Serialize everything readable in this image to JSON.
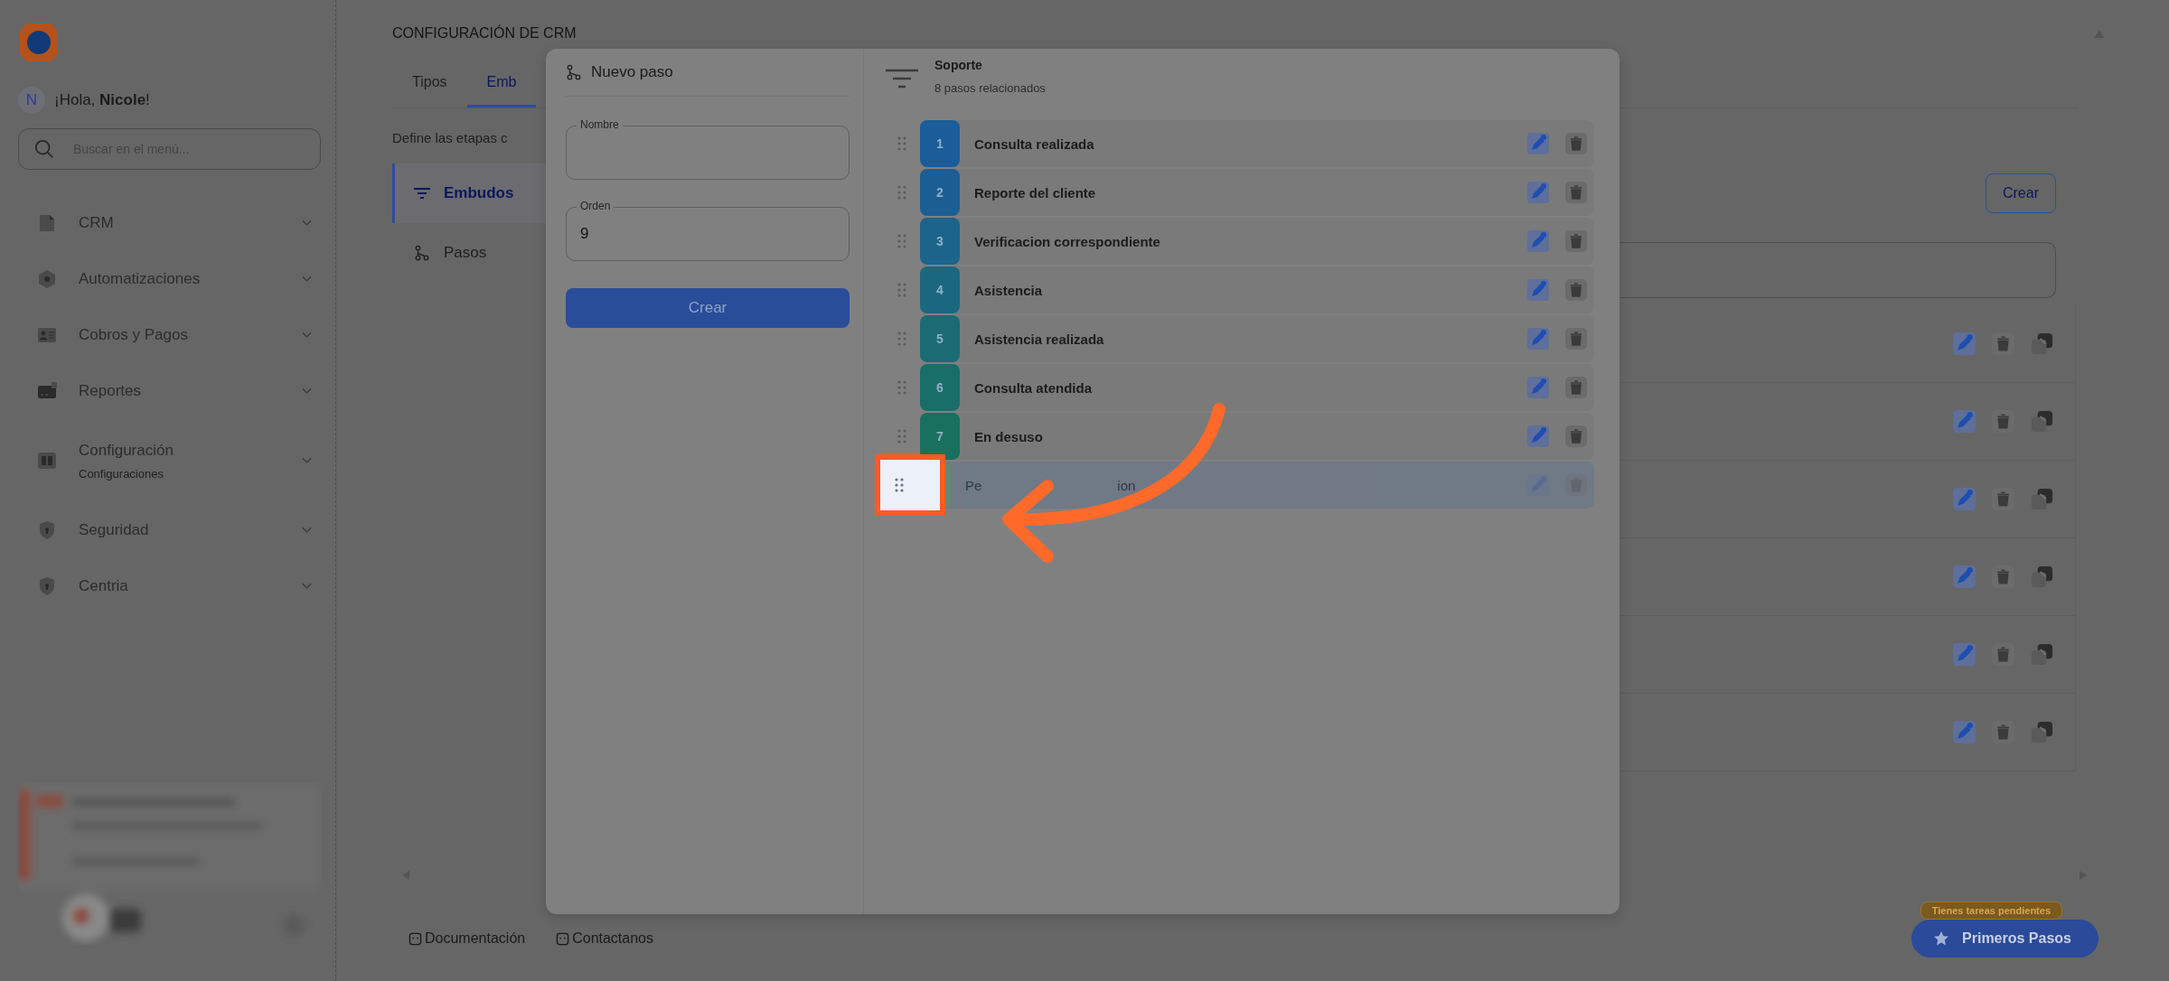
{
  "sidebar": {
    "avatar_initial": "N",
    "greeting": "¡Hola, **Nicole**!",
    "search": {
      "placeholder": "Buscar en el menú..."
    },
    "items": [
      {
        "label": "CRM",
        "expanded": false
      },
      {
        "label": "Automatizaciones",
        "expanded": false
      },
      {
        "label": "Cobros y Pagos",
        "expanded": false
      },
      {
        "label": "Reportes",
        "expanded": false
      },
      {
        "label": "Configuración",
        "sublabel": "Configuraciones",
        "expanded": false
      },
      {
        "label": "Seguridad",
        "expanded": false
      },
      {
        "label": "Centria",
        "expanded": false
      }
    ]
  },
  "page": {
    "title": "CONFIGURACIÓN DE CRM",
    "tabs": [
      {
        "label": "Tipos",
        "selected": false
      },
      {
        "label": "Emb",
        "selected": true
      }
    ],
    "description": "Define las etapas c",
    "subnav": [
      {
        "label": "Embudos",
        "selected": true
      },
      {
        "label": "Pasos",
        "selected": false
      }
    ],
    "create_button": "Crear"
  },
  "footer": {
    "links": [
      "Documentación",
      "Contactanos"
    ]
  },
  "tasks_badge": "Tienes tareas pendientes",
  "first_steps_button": "Primeros Pasos",
  "modal": {
    "form": {
      "title": "Nuevo paso",
      "fields": [
        {
          "label": "Nombre"
        },
        {
          "label": "Orden",
          "value": "9"
        }
      ],
      "submit": "Crear"
    },
    "funnel": {
      "name": "Soporte",
      "subtitle": "8 pasos relacionados",
      "steps": [
        {
          "number": "1",
          "label": "Consulta realizada",
          "color": "#1b5c9a",
          "dragging": false,
          "highlighted": false
        },
        {
          "number": "2",
          "label": "Reporte del cliente",
          "color": "#1b5e94",
          "dragging": false,
          "highlighted": false
        },
        {
          "number": "3",
          "label": "Verificacion correspondiente",
          "color": "#1c6489",
          "dragging": false,
          "highlighted": false
        },
        {
          "number": "4",
          "label": "Asistencia",
          "color": "#1b6780",
          "dragging": false,
          "highlighted": false
        },
        {
          "number": "5",
          "label": "Asistencia realizada",
          "color": "#1b6b74",
          "dragging": false,
          "highlighted": false
        },
        {
          "number": "6",
          "label": "Consulta atendida",
          "color": "#1a6e69",
          "dragging": false,
          "highlighted": false
        },
        {
          "number": "7",
          "label": "En desuso",
          "color": "#1a705f",
          "dragging": false,
          "highlighted": false
        },
        {
          "label": "Pe",
          "label_tail": "ion",
          "color": "#5a8c74",
          "dragging": true,
          "highlighted": true
        }
      ]
    }
  }
}
